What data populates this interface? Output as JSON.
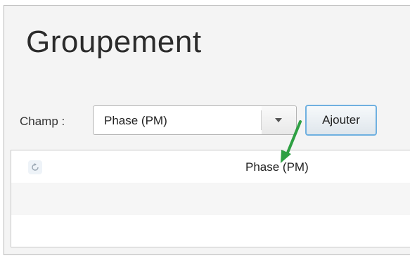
{
  "page": {
    "title": "Groupement"
  },
  "form": {
    "field_label": "Champ :",
    "combo_value": "Phase (PM)",
    "add_button_label": "Ajouter"
  },
  "table": {
    "rows": [
      {
        "label": "Phase (PM)",
        "icon": "refresh-icon"
      },
      {
        "label": ""
      },
      {
        "label": ""
      }
    ]
  },
  "colors": {
    "annotation_arrow": "#2ea043",
    "button_border": "#6fb0e0"
  }
}
